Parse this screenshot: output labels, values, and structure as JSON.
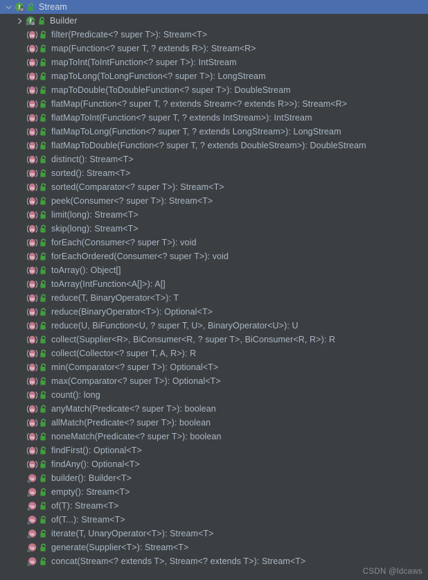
{
  "window": {
    "title": "Stream",
    "watermark": "CSDN @ldcaws",
    "background_color": "#3c3f41",
    "selection_color": "#4b6eaf",
    "text_color": "#a9b7c6",
    "method_icon_color": "#c9788c",
    "interface_icon_color": "#5a9e56",
    "lock_icon_color": "#4caf50"
  },
  "tree": {
    "nodes": [
      {
        "label": "Stream",
        "icon": "interface-icon",
        "access_icon": "public-lock-icon",
        "depth": 0,
        "selected": true,
        "toggle": "chevron-down-icon",
        "kind": "type"
      },
      {
        "label": "Builder",
        "icon": "nested-interface-icon",
        "access_icon": "public-lock-icon",
        "depth": 1,
        "selected": false,
        "toggle": "chevron-right-icon",
        "kind": "type"
      },
      {
        "label": "filter(Predicate<? super T>): Stream<T>",
        "icon": "method-icon",
        "access_icon": "public-lock-icon",
        "depth": 2,
        "selected": false,
        "toggle": "none",
        "kind": "method"
      },
      {
        "label": "map(Function<? super T, ? extends R>): Stream<R>",
        "icon": "method-icon",
        "access_icon": "public-lock-icon",
        "depth": 2,
        "selected": false,
        "toggle": "none",
        "kind": "method"
      },
      {
        "label": "mapToInt(ToIntFunction<? super T>): IntStream",
        "icon": "method-icon",
        "access_icon": "public-lock-icon",
        "depth": 2,
        "selected": false,
        "toggle": "none",
        "kind": "method"
      },
      {
        "label": "mapToLong(ToLongFunction<? super T>): LongStream",
        "icon": "method-icon",
        "access_icon": "public-lock-icon",
        "depth": 2,
        "selected": false,
        "toggle": "none",
        "kind": "method"
      },
      {
        "label": "mapToDouble(ToDoubleFunction<? super T>): DoubleStream",
        "icon": "method-icon",
        "access_icon": "public-lock-icon",
        "depth": 2,
        "selected": false,
        "toggle": "none",
        "kind": "method"
      },
      {
        "label": "flatMap(Function<? super T, ? extends Stream<? extends R>>): Stream<R>",
        "icon": "method-icon",
        "access_icon": "public-lock-icon",
        "depth": 2,
        "selected": false,
        "toggle": "none",
        "kind": "method"
      },
      {
        "label": "flatMapToInt(Function<? super T, ? extends IntStream>): IntStream",
        "icon": "method-icon",
        "access_icon": "public-lock-icon",
        "depth": 2,
        "selected": false,
        "toggle": "none",
        "kind": "method"
      },
      {
        "label": "flatMapToLong(Function<? super T, ? extends LongStream>): LongStream",
        "icon": "method-icon",
        "access_icon": "public-lock-icon",
        "depth": 2,
        "selected": false,
        "toggle": "none",
        "kind": "method"
      },
      {
        "label": "flatMapToDouble(Function<? super T, ? extends DoubleStream>): DoubleStream",
        "icon": "method-icon",
        "access_icon": "public-lock-icon",
        "depth": 2,
        "selected": false,
        "toggle": "none",
        "kind": "method"
      },
      {
        "label": "distinct(): Stream<T>",
        "icon": "method-icon",
        "access_icon": "public-lock-icon",
        "depth": 2,
        "selected": false,
        "toggle": "none",
        "kind": "method"
      },
      {
        "label": "sorted(): Stream<T>",
        "icon": "method-icon",
        "access_icon": "public-lock-icon",
        "depth": 2,
        "selected": false,
        "toggle": "none",
        "kind": "method"
      },
      {
        "label": "sorted(Comparator<? super T>): Stream<T>",
        "icon": "method-icon",
        "access_icon": "public-lock-icon",
        "depth": 2,
        "selected": false,
        "toggle": "none",
        "kind": "method"
      },
      {
        "label": "peek(Consumer<? super T>): Stream<T>",
        "icon": "method-icon",
        "access_icon": "public-lock-icon",
        "depth": 2,
        "selected": false,
        "toggle": "none",
        "kind": "method"
      },
      {
        "label": "limit(long): Stream<T>",
        "icon": "method-icon",
        "access_icon": "public-lock-icon",
        "depth": 2,
        "selected": false,
        "toggle": "none",
        "kind": "method"
      },
      {
        "label": "skip(long): Stream<T>",
        "icon": "method-icon",
        "access_icon": "public-lock-icon",
        "depth": 2,
        "selected": false,
        "toggle": "none",
        "kind": "method"
      },
      {
        "label": "forEach(Consumer<? super T>): void",
        "icon": "method-icon",
        "access_icon": "public-lock-icon",
        "depth": 2,
        "selected": false,
        "toggle": "none",
        "kind": "method"
      },
      {
        "label": "forEachOrdered(Consumer<? super T>): void",
        "icon": "method-icon",
        "access_icon": "public-lock-icon",
        "depth": 2,
        "selected": false,
        "toggle": "none",
        "kind": "method"
      },
      {
        "label": "toArray(): Object[]",
        "icon": "method-icon",
        "access_icon": "public-lock-icon",
        "depth": 2,
        "selected": false,
        "toggle": "none",
        "kind": "method"
      },
      {
        "label": "toArray(IntFunction<A[]>): A[]",
        "icon": "method-icon",
        "access_icon": "public-lock-icon",
        "depth": 2,
        "selected": false,
        "toggle": "none",
        "kind": "method"
      },
      {
        "label": "reduce(T, BinaryOperator<T>): T",
        "icon": "method-icon",
        "access_icon": "public-lock-icon",
        "depth": 2,
        "selected": false,
        "toggle": "none",
        "kind": "method"
      },
      {
        "label": "reduce(BinaryOperator<T>): Optional<T>",
        "icon": "method-icon",
        "access_icon": "public-lock-icon",
        "depth": 2,
        "selected": false,
        "toggle": "none",
        "kind": "method"
      },
      {
        "label": "reduce(U, BiFunction<U, ? super T, U>, BinaryOperator<U>): U",
        "icon": "method-icon",
        "access_icon": "public-lock-icon",
        "depth": 2,
        "selected": false,
        "toggle": "none",
        "kind": "method"
      },
      {
        "label": "collect(Supplier<R>, BiConsumer<R, ? super T>, BiConsumer<R, R>): R",
        "icon": "method-icon",
        "access_icon": "public-lock-icon",
        "depth": 2,
        "selected": false,
        "toggle": "none",
        "kind": "method"
      },
      {
        "label": "collect(Collector<? super T, A, R>): R",
        "icon": "method-icon",
        "access_icon": "public-lock-icon",
        "depth": 2,
        "selected": false,
        "toggle": "none",
        "kind": "method"
      },
      {
        "label": "min(Comparator<? super T>): Optional<T>",
        "icon": "method-icon",
        "access_icon": "public-lock-icon",
        "depth": 2,
        "selected": false,
        "toggle": "none",
        "kind": "method"
      },
      {
        "label": "max(Comparator<? super T>): Optional<T>",
        "icon": "method-icon",
        "access_icon": "public-lock-icon",
        "depth": 2,
        "selected": false,
        "toggle": "none",
        "kind": "method"
      },
      {
        "label": "count(): long",
        "icon": "method-icon",
        "access_icon": "public-lock-icon",
        "depth": 2,
        "selected": false,
        "toggle": "none",
        "kind": "method"
      },
      {
        "label": "anyMatch(Predicate<? super T>): boolean",
        "icon": "method-icon",
        "access_icon": "public-lock-icon",
        "depth": 2,
        "selected": false,
        "toggle": "none",
        "kind": "method"
      },
      {
        "label": "allMatch(Predicate<? super T>): boolean",
        "icon": "method-icon",
        "access_icon": "public-lock-icon",
        "depth": 2,
        "selected": false,
        "toggle": "none",
        "kind": "method"
      },
      {
        "label": "noneMatch(Predicate<? super T>): boolean",
        "icon": "method-icon",
        "access_icon": "public-lock-icon",
        "depth": 2,
        "selected": false,
        "toggle": "none",
        "kind": "method"
      },
      {
        "label": "findFirst(): Optional<T>",
        "icon": "method-icon",
        "access_icon": "public-lock-icon",
        "depth": 2,
        "selected": false,
        "toggle": "none",
        "kind": "method"
      },
      {
        "label": "findAny(): Optional<T>",
        "icon": "method-icon",
        "access_icon": "public-lock-icon",
        "depth": 2,
        "selected": false,
        "toggle": "none",
        "kind": "method"
      },
      {
        "label": "builder(): Builder<T>",
        "icon": "static-method-icon",
        "access_icon": "public-lock-icon",
        "depth": 2,
        "selected": false,
        "toggle": "none",
        "kind": "static-method"
      },
      {
        "label": "empty(): Stream<T>",
        "icon": "static-method-icon",
        "access_icon": "public-lock-icon",
        "depth": 2,
        "selected": false,
        "toggle": "none",
        "kind": "static-method"
      },
      {
        "label": "of(T): Stream<T>",
        "icon": "static-method-icon",
        "access_icon": "public-lock-icon",
        "depth": 2,
        "selected": false,
        "toggle": "none",
        "kind": "static-method"
      },
      {
        "label": "of(T...): Stream<T>",
        "icon": "static-method-icon",
        "access_icon": "public-lock-icon",
        "depth": 2,
        "selected": false,
        "toggle": "none",
        "kind": "static-method"
      },
      {
        "label": "iterate(T, UnaryOperator<T>): Stream<T>",
        "icon": "static-method-icon",
        "access_icon": "public-lock-icon",
        "depth": 2,
        "selected": false,
        "toggle": "none",
        "kind": "static-method"
      },
      {
        "label": "generate(Supplier<T>): Stream<T>",
        "icon": "static-method-icon",
        "access_icon": "public-lock-icon",
        "depth": 2,
        "selected": false,
        "toggle": "none",
        "kind": "static-method"
      },
      {
        "label": "concat(Stream<? extends T>, Stream<? extends T>): Stream<T>",
        "icon": "static-method-icon",
        "access_icon": "public-lock-icon",
        "depth": 2,
        "selected": false,
        "toggle": "none",
        "kind": "static-method"
      }
    ]
  }
}
